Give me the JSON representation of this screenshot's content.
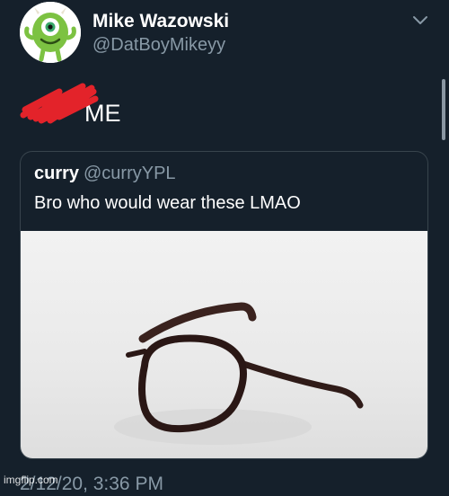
{
  "tweet": {
    "author_name": "Mike Wazowski",
    "author_handle": "@DatBoyMikeyy",
    "text": "ME",
    "timestamp": "2/12/20, 3:36 PM",
    "avatar_icon": "mike-wazowski-avatar",
    "menu_icon": "chevron-down-icon"
  },
  "quoted_tweet": {
    "author_name": "curry",
    "author_handle": "@curryYPL",
    "text": "Bro who would wear these LMAO",
    "image_icon": "glasses-photo"
  },
  "watermark": "imgflip.com",
  "colors": {
    "background": "#15202b",
    "secondary_text": "#8899a6",
    "border": "#38444d",
    "scribble": "#e3232a"
  }
}
